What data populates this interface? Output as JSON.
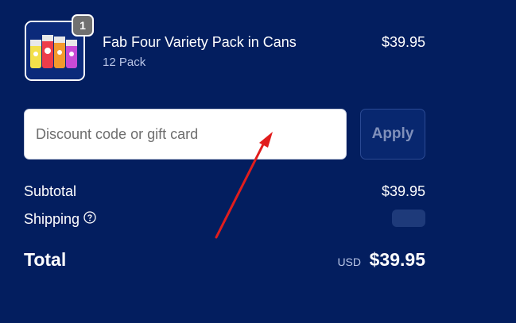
{
  "line_item": {
    "quantity": "1",
    "name": "Fab Four Variety Pack in Cans",
    "variant": "12 Pack",
    "price": "$39.95"
  },
  "discount": {
    "placeholder": "Discount code or gift card",
    "value": "",
    "apply_label": "Apply"
  },
  "totals": {
    "subtotal_label": "Subtotal",
    "subtotal_value": "$39.95",
    "shipping_label": "Shipping",
    "total_label": "Total",
    "currency": "USD",
    "total_value": "$39.95"
  },
  "icons": {
    "help": "question-circle-icon",
    "product_thumbnail": "four-cans-image"
  },
  "colors": {
    "background": "#031e5f",
    "annotation": "#e11d1d"
  }
}
